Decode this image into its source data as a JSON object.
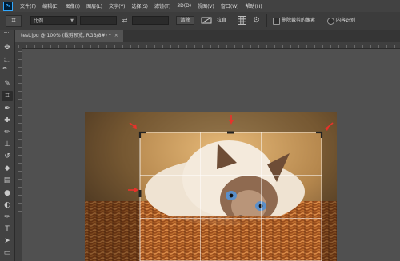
{
  "menu": {
    "logo": "Ps",
    "items": [
      "文件(F)",
      "编辑(E)",
      "图像(I)",
      "图层(L)",
      "文字(Y)",
      "选择(S)",
      "滤镜(T)",
      "3D(D)",
      "视图(V)",
      "窗口(W)",
      "帮助(H)"
    ]
  },
  "options": {
    "ratio_value": "比例",
    "clear_label": "清除",
    "straighten_label": "拉直",
    "delete_cropped_label": "删除裁剪的像素",
    "content_aware_label": "内容识别"
  },
  "document": {
    "tab_title": "test.jpg @ 100% (裁剪预览, RGB/8#) *",
    "close_glyph": "×"
  },
  "colors": {
    "accent": "#31a8ff",
    "crop_arrow": "#e8322b",
    "ui_dark": "#424242"
  }
}
